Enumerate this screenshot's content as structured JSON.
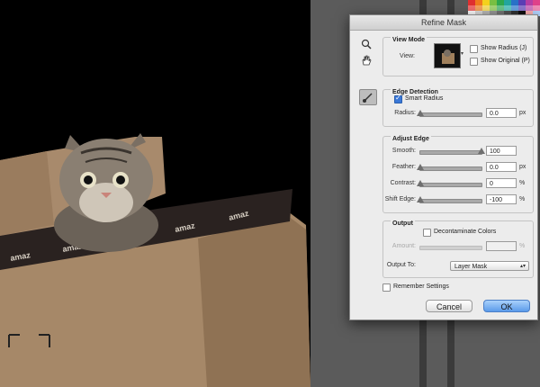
{
  "dialog": {
    "title": "Refine Mask",
    "tools": {
      "zoom": "zoom-icon",
      "hand": "hand-icon",
      "refine_brush": "refine-brush-icon"
    },
    "view_mode": {
      "legend": "View Mode",
      "view_label": "View:",
      "show_radius": {
        "label": "Show Radius (J)",
        "checked": false
      },
      "show_original": {
        "label": "Show Original (P)",
        "checked": false
      }
    },
    "edge_detection": {
      "legend": "Edge Detection",
      "smart_radius": {
        "label": "Smart Radius",
        "checked": true
      },
      "radius": {
        "label": "Radius:",
        "value": "0.0",
        "unit": "px",
        "level": 0.0
      }
    },
    "adjust_edge": {
      "legend": "Adjust Edge",
      "smooth": {
        "label": "Smooth:",
        "value": "100",
        "unit": "",
        "level": 1.0
      },
      "feather": {
        "label": "Feather:",
        "value": "0.0",
        "unit": "px",
        "level": 0.0
      },
      "contrast": {
        "label": "Contrast:",
        "value": "0",
        "unit": "%",
        "level": 0.0
      },
      "shift_edge": {
        "label": "Shift Edge:",
        "value": "-100",
        "unit": "%",
        "level": 0.0
      }
    },
    "output": {
      "legend": "Output",
      "decontaminate": {
        "label": "Decontaminate Colors",
        "checked": false
      },
      "amount": {
        "label": "Amount:",
        "value": "",
        "unit": "%"
      },
      "output_to_label": "Output To:",
      "output_to_value": "Layer Mask"
    },
    "remember_settings": {
      "label": "Remember Settings",
      "checked": false
    },
    "buttons": {
      "cancel": "Cancel",
      "ok": "OK"
    }
  },
  "colors": {
    "ok_button": "#5b9bea",
    "dialog_bg": "#ececec",
    "checkbox_checked": "#3a78d8"
  }
}
